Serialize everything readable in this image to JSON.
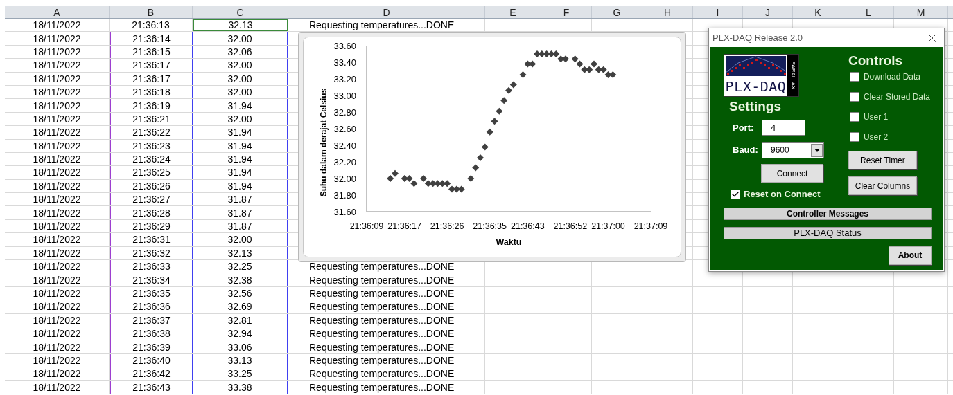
{
  "sheet": {
    "columns": [
      "A",
      "B",
      "C",
      "D",
      "E",
      "F",
      "G",
      "H",
      "I",
      "J",
      "K",
      "L",
      "M"
    ],
    "rows": [
      {
        "date": "18/11/2022",
        "time": "21:36:13",
        "temp": "32.13",
        "note": "Requesting temperatures...DONE"
      },
      {
        "date": "18/11/2022",
        "time": "21:36:14",
        "temp": "32.00"
      },
      {
        "date": "18/11/2022",
        "time": "21:36:15",
        "temp": "32.06"
      },
      {
        "date": "18/11/2022",
        "time": "21:36:17",
        "temp": "32.00"
      },
      {
        "date": "18/11/2022",
        "time": "21:36:17",
        "temp": "32.00"
      },
      {
        "date": "18/11/2022",
        "time": "21:36:18",
        "temp": "32.00"
      },
      {
        "date": "18/11/2022",
        "time": "21:36:19",
        "temp": "31.94"
      },
      {
        "date": "18/11/2022",
        "time": "21:36:21",
        "temp": "32.00"
      },
      {
        "date": "18/11/2022",
        "time": "21:36:22",
        "temp": "31.94"
      },
      {
        "date": "18/11/2022",
        "time": "21:36:23",
        "temp": "31.94"
      },
      {
        "date": "18/11/2022",
        "time": "21:36:24",
        "temp": "31.94"
      },
      {
        "date": "18/11/2022",
        "time": "21:36:25",
        "temp": "31.94"
      },
      {
        "date": "18/11/2022",
        "time": "21:36:26",
        "temp": "31.94"
      },
      {
        "date": "18/11/2022",
        "time": "21:36:27",
        "temp": "31.87"
      },
      {
        "date": "18/11/2022",
        "time": "21:36:28",
        "temp": "31.87"
      },
      {
        "date": "18/11/2022",
        "time": "21:36:29",
        "temp": "31.87"
      },
      {
        "date": "18/11/2022",
        "time": "21:36:31",
        "temp": "32.00"
      },
      {
        "date": "18/11/2022",
        "time": "21:36:32",
        "temp": "32.13"
      },
      {
        "date": "18/11/2022",
        "time": "21:36:33",
        "temp": "32.25",
        "note": "Requesting temperatures...DONE"
      },
      {
        "date": "18/11/2022",
        "time": "21:36:34",
        "temp": "32.38",
        "note": "Requesting temperatures...DONE"
      },
      {
        "date": "18/11/2022",
        "time": "21:36:35",
        "temp": "32.56",
        "note": "Requesting temperatures...DONE"
      },
      {
        "date": "18/11/2022",
        "time": "21:36:36",
        "temp": "32.69",
        "note": "Requesting temperatures...DONE"
      },
      {
        "date": "18/11/2022",
        "time": "21:36:37",
        "temp": "32.81",
        "note": "Requesting temperatures...DONE"
      },
      {
        "date": "18/11/2022",
        "time": "21:36:38",
        "temp": "32.94",
        "note": "Requesting temperatures...DONE"
      },
      {
        "date": "18/11/2022",
        "time": "21:36:39",
        "temp": "33.06",
        "note": "Requesting temperatures...DONE"
      },
      {
        "date": "18/11/2022",
        "time": "21:36:40",
        "temp": "33.13",
        "note": "Requesting temperatures...DONE"
      },
      {
        "date": "18/11/2022",
        "time": "21:36:42",
        "temp": "33.25",
        "note": "Requesting temperatures...DONE"
      },
      {
        "date": "18/11/2022",
        "time": "21:36:43",
        "temp": "33.38",
        "note": "Requesting temperatures...DONE"
      }
    ]
  },
  "chart": {
    "chart_data": {
      "type": "scatter",
      "xlabel": "Waktu",
      "ylabel": "Suhu dalam derajat Celsius",
      "x": [
        77774,
        77775,
        77777,
        77778,
        77779,
        77781,
        77782,
        77783,
        77784,
        77785,
        77786,
        77787,
        77788,
        77789,
        77791,
        77792,
        77793,
        77794,
        77795,
        77796,
        77797,
        77798,
        77799,
        77800,
        77802,
        77803,
        77804,
        77805,
        77806,
        77807,
        77808,
        77809,
        77810,
        77811,
        77813,
        77814,
        77815,
        77816,
        77817,
        77818,
        77819,
        77820,
        77821
      ],
      "series": [
        {
          "color": "#404040",
          "values": [
            32.0,
            32.06,
            32.0,
            32.0,
            31.94,
            32.0,
            31.94,
            31.94,
            31.94,
            31.94,
            31.94,
            31.87,
            31.87,
            31.87,
            32.0,
            32.13,
            32.25,
            32.38,
            32.56,
            32.69,
            32.81,
            32.94,
            33.06,
            33.13,
            33.25,
            33.38,
            33.38,
            33.5,
            33.5,
            33.5,
            33.5,
            33.5,
            33.44,
            33.44,
            33.44,
            33.38,
            33.31,
            33.31,
            33.38,
            33.31,
            33.31,
            33.25,
            33.25
          ]
        }
      ],
      "xlim": [
        77769,
        77829
      ],
      "ylim": [
        31.6,
        33.6
      ],
      "xticks": [
        {
          "value": 77769,
          "label": "21:36:09"
        },
        {
          "value": 77777,
          "label": "21:36:17"
        },
        {
          "value": 77786,
          "label": "21:36:26"
        },
        {
          "value": 77795,
          "label": "21:36:35"
        },
        {
          "value": 77803,
          "label": "21:36:43"
        },
        {
          "value": 77812,
          "label": "21:36:52"
        },
        {
          "value": 77820,
          "label": "21:37:00"
        },
        {
          "value": 77829,
          "label": "21:37:09"
        }
      ],
      "yticks": [
        {
          "value": 31.6,
          "label": "31.60"
        },
        {
          "value": 31.8,
          "label": "31.80"
        },
        {
          "value": 32.0,
          "label": "32.00"
        },
        {
          "value": 32.2,
          "label": "32.20"
        },
        {
          "value": 32.4,
          "label": "32.40"
        },
        {
          "value": 32.6,
          "label": "32.60"
        },
        {
          "value": 32.8,
          "label": "32.80"
        },
        {
          "value": 33.0,
          "label": "33.00"
        },
        {
          "value": 33.2,
          "label": "33.20"
        },
        {
          "value": 33.4,
          "label": "33.40"
        },
        {
          "value": 33.6,
          "label": "33.60"
        }
      ]
    }
  },
  "dialog": {
    "title": "PLX-DAQ Release 2.0",
    "logo": {
      "text": "PLX-DAQ",
      "side_text": "PARALLAX"
    },
    "settings": {
      "heading": "Settings",
      "port_label": "Port:",
      "port_value": "4",
      "baud_label": "Baud:",
      "baud_value": "9600",
      "connect": "Connect",
      "reset_on_connect": {
        "label": "Reset on Connect",
        "checked": true
      }
    },
    "controls": {
      "heading": "Controls",
      "checkboxes": [
        {
          "label": "Download Data",
          "checked": false
        },
        {
          "label": "Clear Stored Data",
          "checked": false
        },
        {
          "label": "User 1",
          "checked": false
        },
        {
          "label": "User 2",
          "checked": false
        }
      ],
      "buttons": [
        "Reset Timer",
        "Clear Columns"
      ]
    },
    "controller_messages": "Controller Messages",
    "status": "PLX-DAQ Status",
    "about": "About"
  }
}
